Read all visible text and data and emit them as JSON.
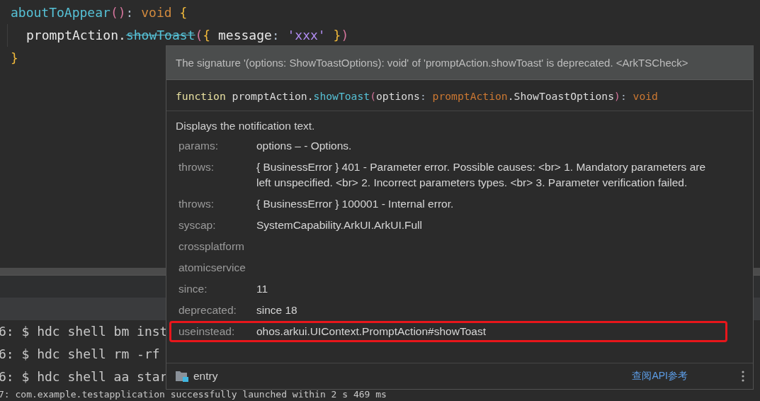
{
  "editor": {
    "lines": [
      {
        "indent": false,
        "tokens": [
          {
            "kind": "function",
            "text": "aboutToAppear"
          },
          {
            "kind": "paren",
            "text": "()"
          },
          {
            "kind": "punct",
            "text": ": "
          },
          {
            "kind": "keyword",
            "text": "void "
          },
          {
            "kind": "brace",
            "text": "{"
          }
        ]
      },
      {
        "indent": true,
        "tokens": [
          {
            "kind": "plain",
            "text": "promptAction."
          },
          {
            "kind": "deprecated",
            "text": "showToast"
          },
          {
            "kind": "paren",
            "text": "("
          },
          {
            "kind": "brace",
            "text": "{ "
          },
          {
            "kind": "plain",
            "text": "message"
          },
          {
            "kind": "punct",
            "text": ": "
          },
          {
            "kind": "string",
            "text": "'xxx'"
          },
          {
            "kind": "brace",
            "text": " }"
          },
          {
            "kind": "paren",
            "text": ")"
          }
        ]
      },
      {
        "indent": false,
        "tokens": [
          {
            "kind": "brace",
            "text": "}"
          }
        ]
      }
    ]
  },
  "terminal": {
    "lines": [
      "6: $ hdc shell bm inst",
      "6: $ hdc shell rm -rf",
      "6: $ hdc shell aa star"
    ],
    "last_line": "7: com.example.testapplication successfully launched within 2 s 469 ms"
  },
  "popup": {
    "warning": "The signature '(options: ShowToastOptions): void' of 'promptAction.showToast' is deprecated. <ArkTSCheck>",
    "signature": [
      {
        "kind": "keyword",
        "text": "function "
      },
      {
        "kind": "plain",
        "text": "promptAction."
      },
      {
        "kind": "function",
        "text": "showToast"
      },
      {
        "kind": "paren",
        "text": "("
      },
      {
        "kind": "plain",
        "text": "options"
      },
      {
        "kind": "punct",
        "text": ": "
      },
      {
        "kind": "type",
        "text": "promptAction"
      },
      {
        "kind": "plain",
        "text": ".ShowToastOptions"
      },
      {
        "kind": "paren",
        "text": ")"
      },
      {
        "kind": "punct",
        "text": ": "
      },
      {
        "kind": "type",
        "text": "void"
      }
    ],
    "description": "Displays the notification text.",
    "fields": [
      {
        "label": "params:",
        "value": "options – - Options.",
        "highlighted": false
      },
      {
        "label": "throws:",
        "value": "{ BusinessError } 401 - Parameter error. Possible causes: <br> 1. Mandatory parameters are left unspecified. <br> 2. Incorrect parameters types. <br> 3. Parameter verification failed.",
        "highlighted": false
      },
      {
        "label": "throws:",
        "value": "{ BusinessError } 100001 - Internal error.",
        "highlighted": false
      },
      {
        "label": "syscap:",
        "value": "SystemCapability.ArkUI.ArkUI.Full",
        "highlighted": false
      },
      {
        "label": "crossplatform",
        "highlighted": false
      },
      {
        "label": "atomicservice",
        "highlighted": false
      },
      {
        "label": "since:",
        "value": "11",
        "highlighted": false
      },
      {
        "label": "deprecated:",
        "value": "since 18",
        "highlighted": false
      },
      {
        "label": "useinstead:",
        "value": "ohos.arkui.UIContext.PromptAction#showToast",
        "highlighted": true
      }
    ],
    "footer": {
      "module": "entry",
      "link": "查阅API参考"
    }
  }
}
